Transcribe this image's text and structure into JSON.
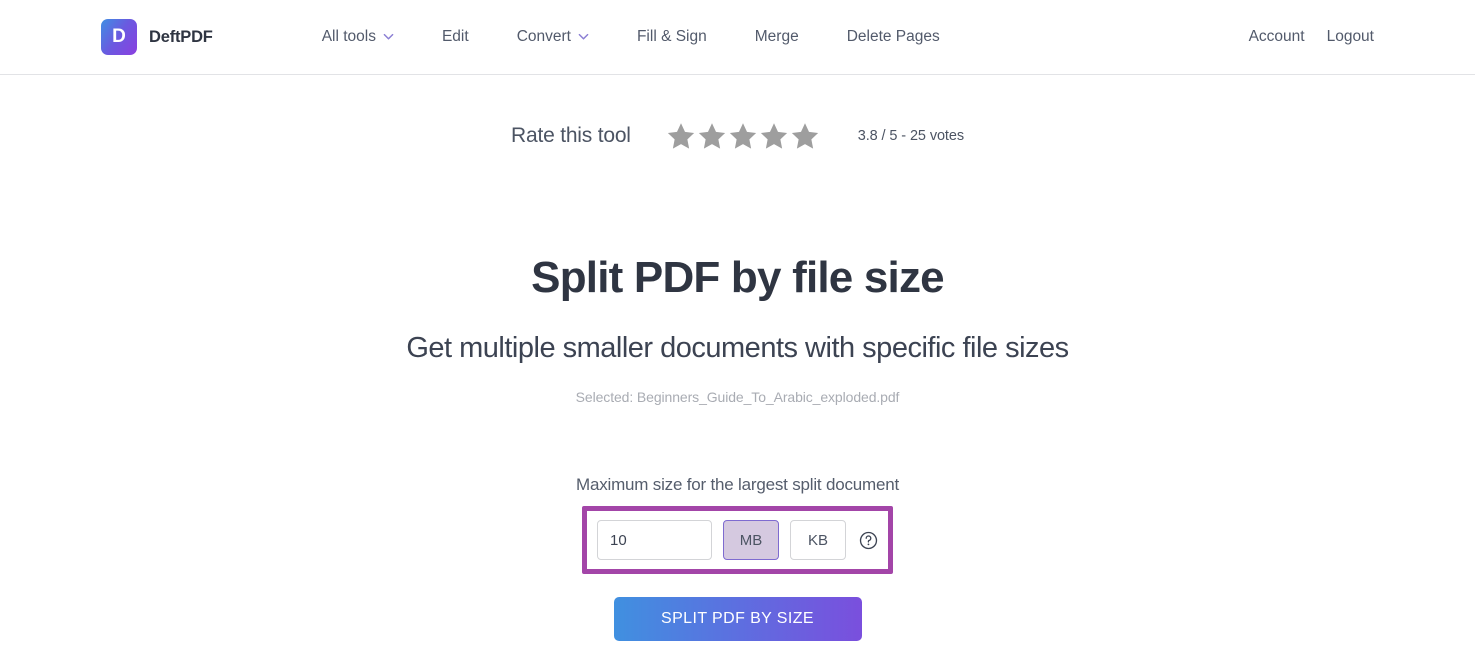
{
  "header": {
    "brand": {
      "logo_letter": "D",
      "name": "DeftPDF"
    },
    "nav": [
      {
        "label": "All tools",
        "has_dropdown": true,
        "icon": "chevron-down-icon"
      },
      {
        "label": "Edit",
        "has_dropdown": false
      },
      {
        "label": "Convert",
        "has_dropdown": true,
        "icon": "chevron-down-icon"
      },
      {
        "label": "Fill & Sign",
        "has_dropdown": false
      },
      {
        "label": "Merge",
        "has_dropdown": false
      },
      {
        "label": "Delete Pages",
        "has_dropdown": false
      }
    ],
    "account_links": [
      {
        "label": "Account"
      },
      {
        "label": "Logout"
      }
    ]
  },
  "rating": {
    "label": "Rate this tool",
    "stars_total": 5,
    "stars_filled": 5,
    "star_color": "#9e9e9e",
    "summary": "3.8 / 5 - 25 votes",
    "score": "3.8",
    "out_of": "5",
    "votes": "25"
  },
  "main": {
    "title": "Split PDF by file size",
    "subtitle": "Get multiple smaller documents with specific file sizes",
    "selected_file": "Selected: Beginners_Guide_To_Arabic_exploded.pdf"
  },
  "form": {
    "label": "Maximum size for the largest split document",
    "size_value": "10",
    "size_placeholder": "",
    "units": [
      {
        "label": "MB",
        "selected": true
      },
      {
        "label": "KB",
        "selected": false
      }
    ],
    "help_icon": "question-circle-icon",
    "submit_label": "SPLIT PDF BY SIZE",
    "highlight_color": "#a345a8",
    "unit_active_bg": "#d5c9e0",
    "submit_gradient_from": "#4090e0",
    "submit_gradient_to": "#7a4fdd"
  }
}
